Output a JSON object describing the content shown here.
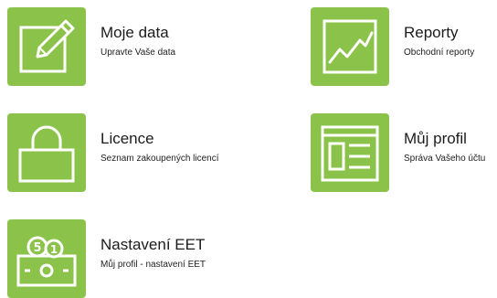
{
  "theme": {
    "tile_color": "#8bc34a",
    "icon_stroke": "#ffffff"
  },
  "tiles": [
    {
      "title": "Moje data",
      "subtitle": "Upravte Vaše data",
      "icon": "edit-icon"
    },
    {
      "title": "Reporty",
      "subtitle": "Obchodní reporty",
      "icon": "chart-icon"
    },
    {
      "title": "Licence",
      "subtitle": "Seznam zakoupených licencí",
      "icon": "lock-icon"
    },
    {
      "title": "Můj profil",
      "subtitle": "Správa Vašeho účtu",
      "icon": "profile-icon"
    },
    {
      "title": "Nastavení EET",
      "subtitle": "Můj profil - nastavení EET",
      "icon": "money-icon"
    }
  ]
}
